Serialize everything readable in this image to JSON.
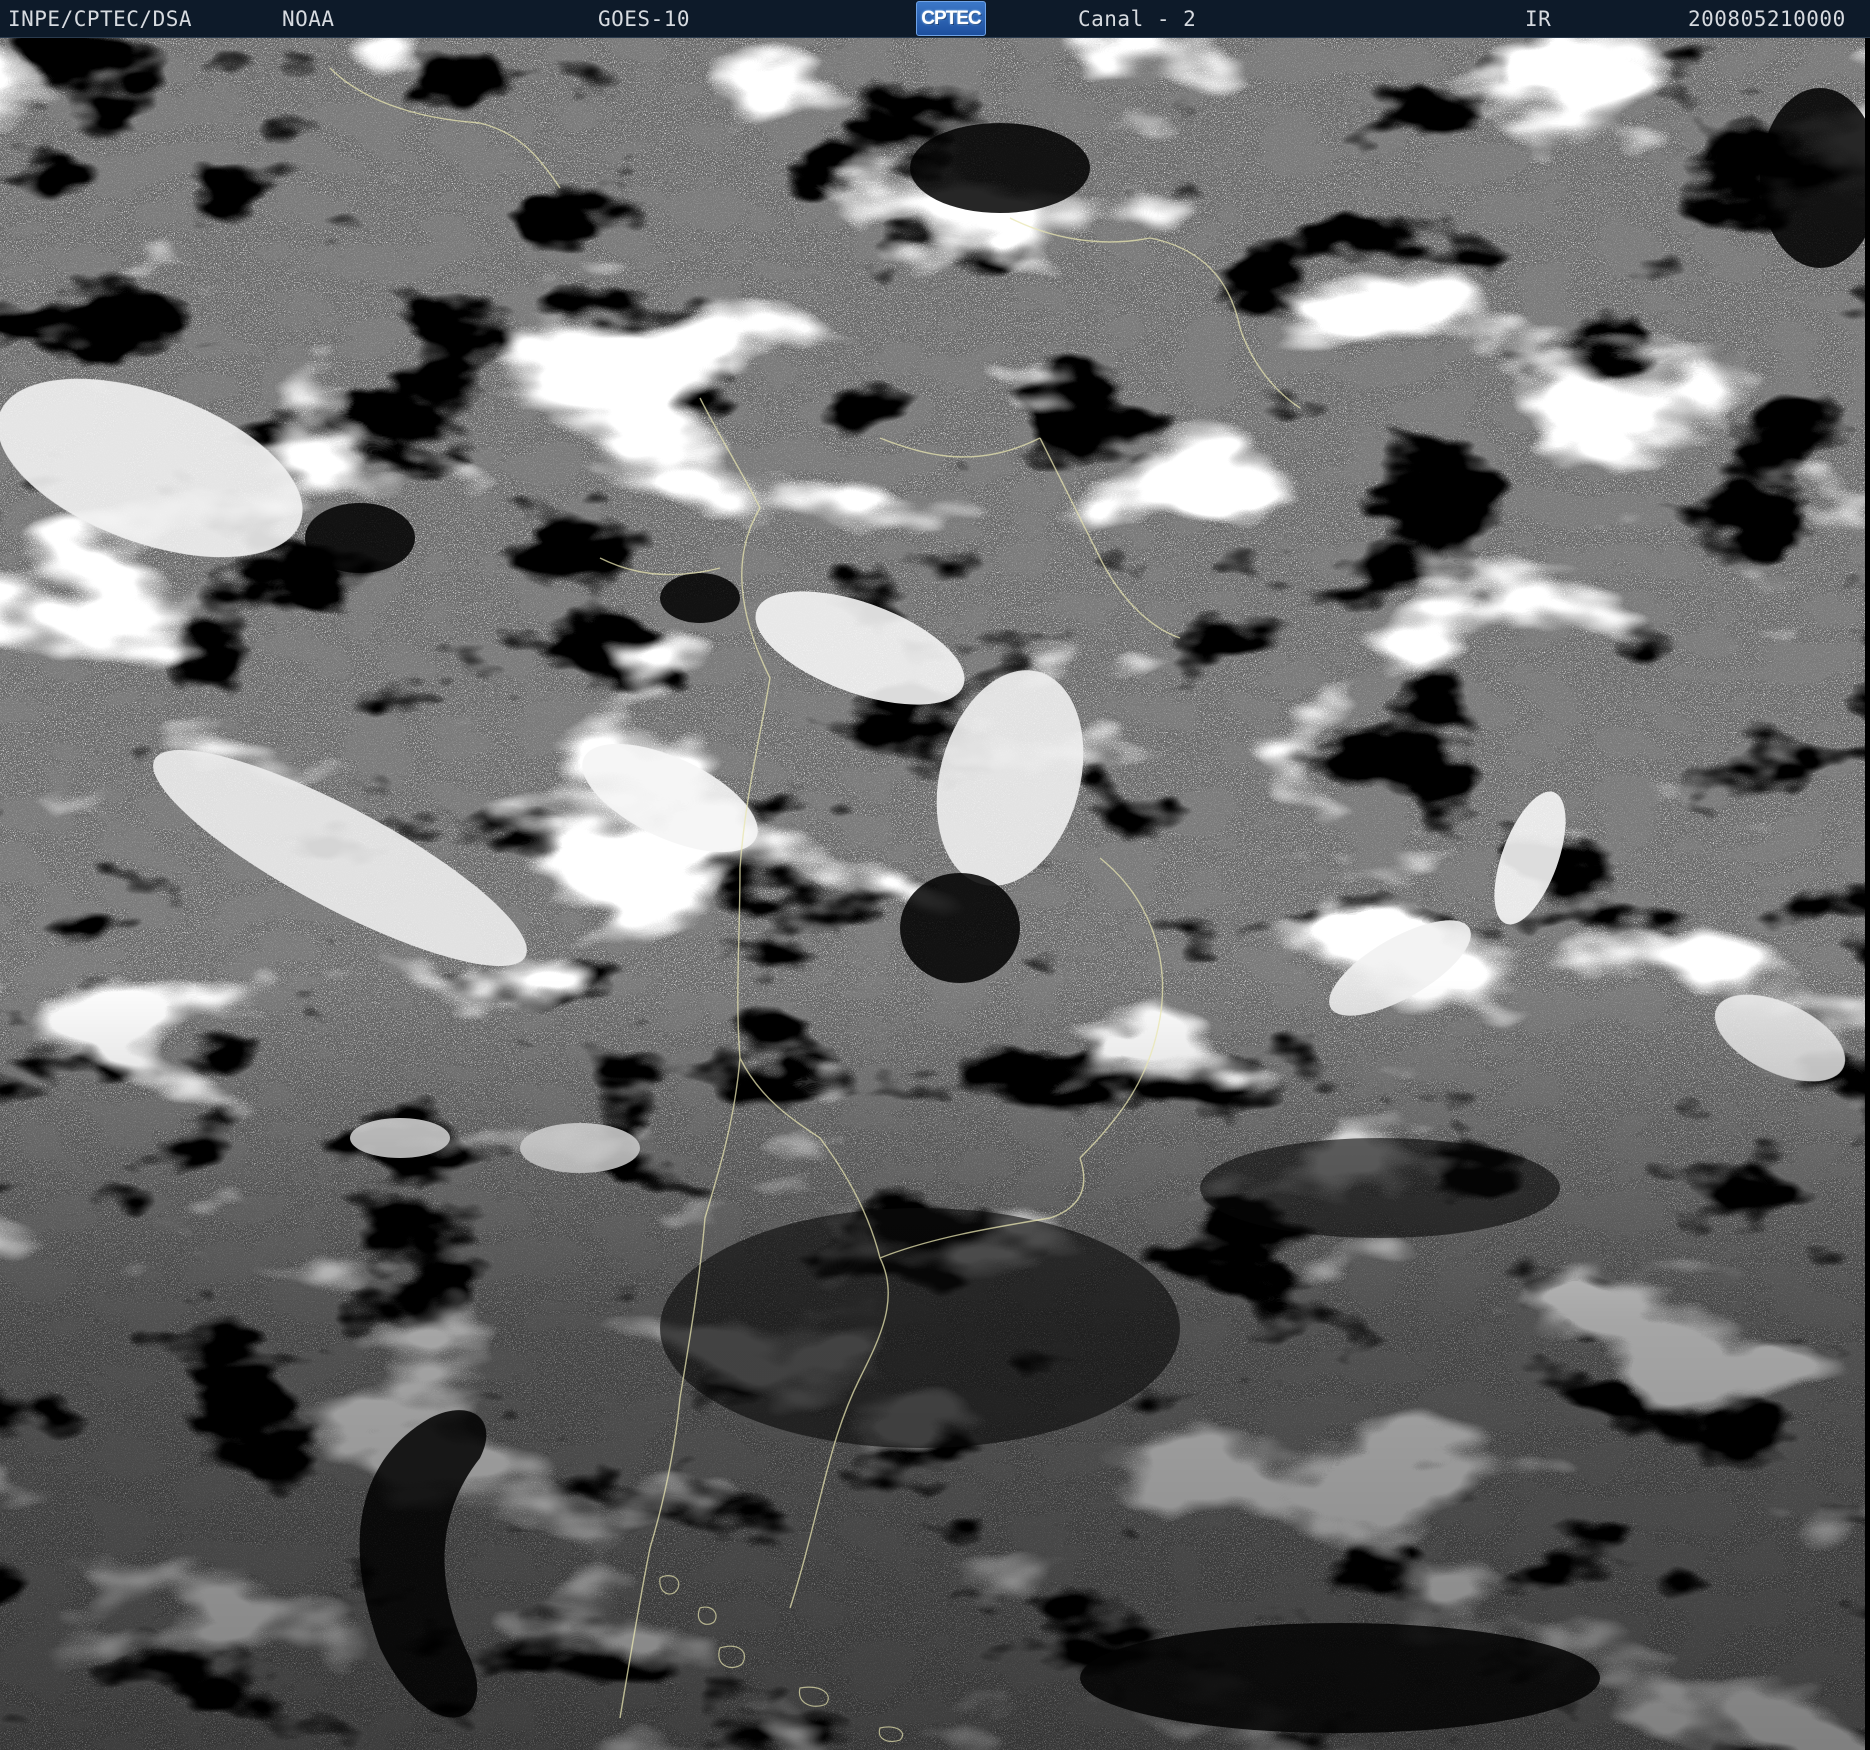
{
  "header": {
    "agency": "INPE/CPTEC/DSA",
    "source": "NOAA",
    "satellite": "GOES-10",
    "logo": "CPTEC",
    "channel": "Canal - 2",
    "band": "IR",
    "timestamp": "200805210000"
  },
  "colors": {
    "header_background": "#0d1a29",
    "header_text": "#d7dbe0",
    "coastline": "#e8e5b0"
  },
  "image": {
    "type": "infrared satellite image (grayscale)"
  }
}
